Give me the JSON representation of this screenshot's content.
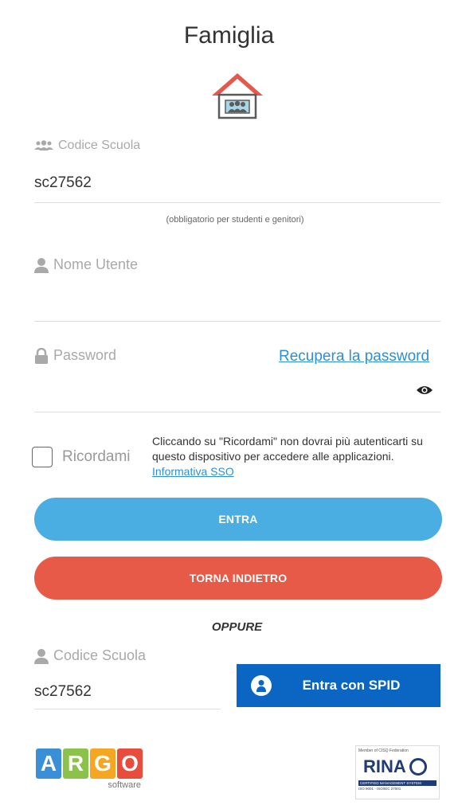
{
  "header": {
    "title": "Famiglia"
  },
  "school_code": {
    "label": "Codice Scuola",
    "value": "sc27562",
    "hint": "(obbligatorio per studenti e genitori)"
  },
  "username": {
    "label": "Nome Utente",
    "value": ""
  },
  "password": {
    "label": "Password",
    "recover_link": "Recupera la password",
    "value": ""
  },
  "remember": {
    "label": "Ricordami",
    "notice": "Cliccando su \"Ricordami\" non dovrai più autenticarti su questo dispositivo per accedere alle applicazioni.",
    "sso_link": "Informativa SSO"
  },
  "buttons": {
    "enter": "ENTRA",
    "back": "TORNA INDIETRO"
  },
  "divider": "OPPURE",
  "spid": {
    "school_label": "Codice Scuola",
    "school_value": "sc27562",
    "button": "Entra con SPID"
  },
  "footer": {
    "argo_letters": [
      "A",
      "R",
      "G",
      "O"
    ],
    "argo_colors": [
      "#3b8fd6",
      "#8bc34a",
      "#f5a623",
      "#e74c3c"
    ],
    "argo_sub": "software",
    "rina_top": "Member of CISQ Federation",
    "rina_mark": "RINA",
    "rina_bar": "CERTIFIED MANAGEMENT SYSTEM",
    "rina_iso": "ISO 9001 · ISO/IEC 27001"
  },
  "colors": {
    "enter": "#4aaee2",
    "back": "#e75a47",
    "spid": "#0a66c2",
    "link": "#2c8fd8"
  }
}
